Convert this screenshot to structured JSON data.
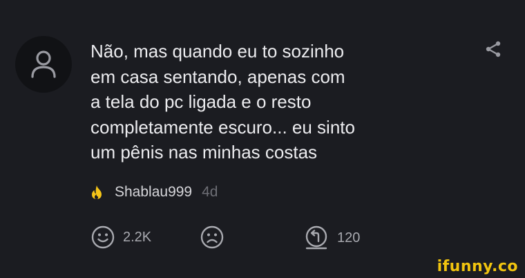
{
  "comment": {
    "text": "Não, mas quando eu to sozinho\nem casa sentando, apenas com\na tela do pc ligada e o resto\ncompletamente escuro... eu sinto\num pênis nas minhas costas",
    "username": "Shablau999",
    "time": "4d"
  },
  "actions": {
    "smile_count": "2.2K",
    "reply_count": "120"
  },
  "icons": {
    "avatar": "user-icon",
    "share": "share-icon",
    "badge": "fire-icon",
    "smile": "smile-icon",
    "unsmile": "unsmile-icon",
    "reply": "reply-icon"
  },
  "colors": {
    "background": "#1b1c21",
    "fire": "#f5c518",
    "logo": "#f1c40f"
  },
  "watermark": "ifunny.co"
}
